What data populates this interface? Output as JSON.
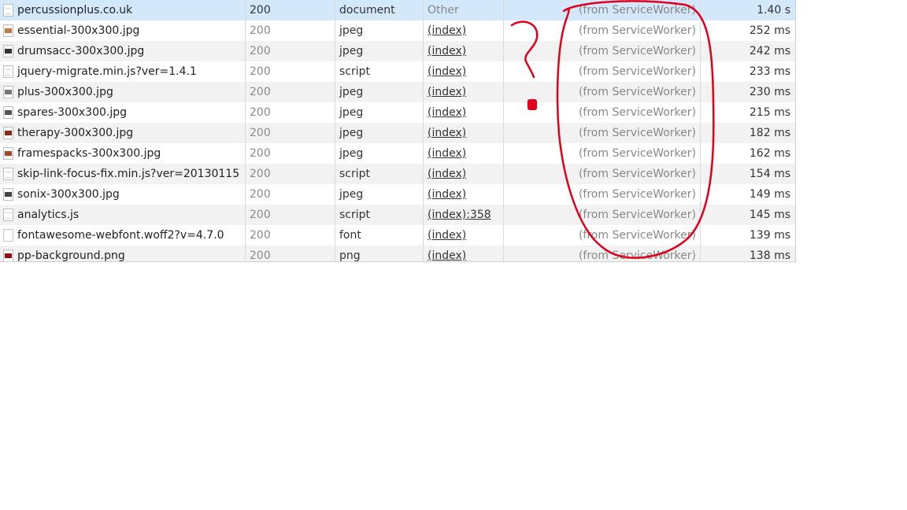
{
  "rows": [
    {
      "name": "percussionplus.co.uk",
      "status": "200",
      "type": "document",
      "initiator": "Other",
      "size": "(from ServiceWorker)",
      "time": "1.40 s",
      "icon": "document-icon",
      "thumb": ""
    },
    {
      "name": "essential-300x300.jpg",
      "status": "200",
      "type": "jpeg",
      "initiator": "(index)",
      "size": "(from ServiceWorker)",
      "time": "252 ms",
      "icon": "image-icon",
      "thumb": "#c07a4a"
    },
    {
      "name": "drumsacc-300x300.jpg",
      "status": "200",
      "type": "jpeg",
      "initiator": "(index)",
      "size": "(from ServiceWorker)",
      "time": "242 ms",
      "icon": "image-icon",
      "thumb": "#333333"
    },
    {
      "name": "jquery-migrate.min.js?ver=1.4.1",
      "status": "200",
      "type": "script",
      "initiator": "(index)",
      "size": "(from ServiceWorker)",
      "time": "233 ms",
      "icon": "script-icon",
      "thumb": ""
    },
    {
      "name": "plus-300x300.jpg",
      "status": "200",
      "type": "jpeg",
      "initiator": "(index)",
      "size": "(from ServiceWorker)",
      "time": "230 ms",
      "icon": "image-icon",
      "thumb": "#777777"
    },
    {
      "name": "spares-300x300.jpg",
      "status": "200",
      "type": "jpeg",
      "initiator": "(index)",
      "size": "(from ServiceWorker)",
      "time": "215 ms",
      "icon": "image-icon",
      "thumb": "#555555"
    },
    {
      "name": "therapy-300x300.jpg",
      "status": "200",
      "type": "jpeg",
      "initiator": "(index)",
      "size": "(from ServiceWorker)",
      "time": "182 ms",
      "icon": "image-icon",
      "thumb": "#8a2a1a"
    },
    {
      "name": "framespacks-300x300.jpg",
      "status": "200",
      "type": "jpeg",
      "initiator": "(index)",
      "size": "(from ServiceWorker)",
      "time": "162 ms",
      "icon": "image-icon",
      "thumb": "#a04a2a"
    },
    {
      "name": "skip-link-focus-fix.min.js?ver=20130115",
      "status": "200",
      "type": "script",
      "initiator": "(index)",
      "size": "(from ServiceWorker)",
      "time": "154 ms",
      "icon": "script-icon",
      "thumb": ""
    },
    {
      "name": "sonix-300x300.jpg",
      "status": "200",
      "type": "jpeg",
      "initiator": "(index)",
      "size": "(from ServiceWorker)",
      "time": "149 ms",
      "icon": "image-icon",
      "thumb": "#444444"
    },
    {
      "name": "analytics.js",
      "status": "200",
      "type": "script",
      "initiator": "(index):358",
      "size": "(from ServiceWorker)",
      "time": "145 ms",
      "icon": "script-icon",
      "thumb": ""
    },
    {
      "name": "fontawesome-webfont.woff2?v=4.7.0",
      "status": "200",
      "type": "font",
      "initiator": "(index)",
      "size": "(from ServiceWorker)",
      "time": "139 ms",
      "icon": "font-icon",
      "thumb": ""
    },
    {
      "name": "pp-background.png",
      "status": "200",
      "type": "png",
      "initiator": "(index)",
      "size": "(from ServiceWorker)",
      "time": "138 ms",
      "icon": "image-icon",
      "thumb": "#8a0f1a"
    }
  ],
  "colors": {
    "selected_row": "#d4e8fb",
    "annotation_red": "#e0001b"
  }
}
